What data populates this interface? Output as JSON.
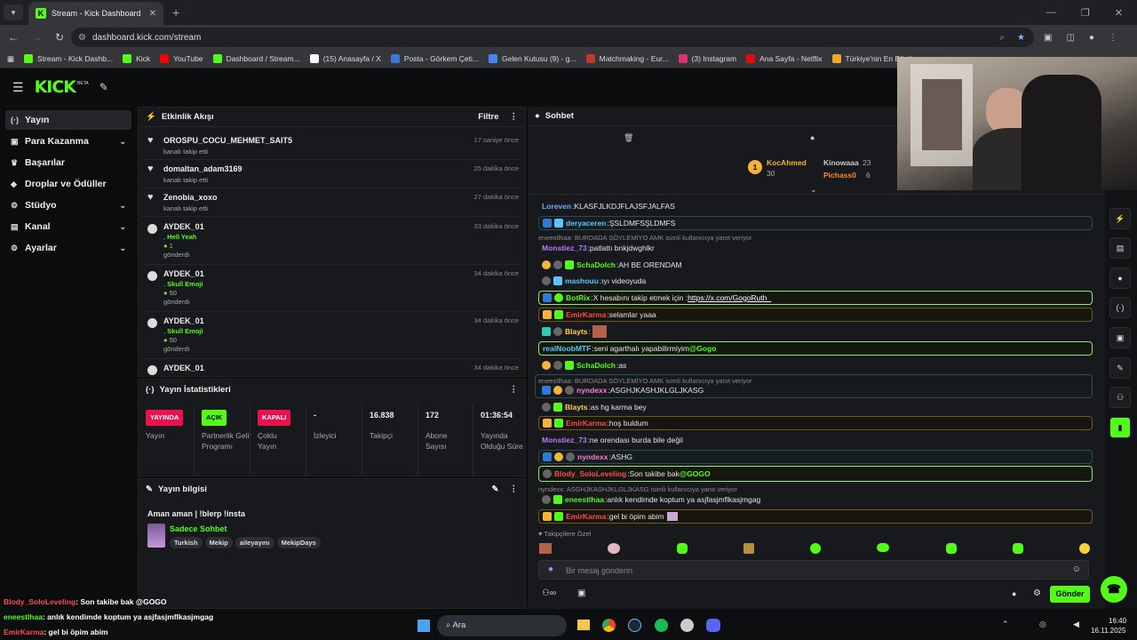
{
  "browser": {
    "tab_title": "Stream - Kick Dashboard",
    "url": "dashboard.kick.com/stream",
    "bookmarks": [
      "Stream - Kick Dashb...",
      "Kick",
      "YouTube",
      "Dashboard / Stream...",
      "(15) Anasayfa / X",
      "Posta - Görkem Çeti...",
      "Gelen Kutusu (9) - g...",
      "Matchmaking - Eur...",
      "(3) Instagram",
      "Ana Sayfa - Netflix",
      "Türkiye'nin En Büyü..."
    ]
  },
  "header": {
    "logo": "KICK",
    "beta": "BETA"
  },
  "sidebar": {
    "items": [
      {
        "label": "Yayın",
        "icon": "(·)"
      },
      {
        "label": "Para Kazanma",
        "icon": "▣"
      },
      {
        "label": "Başarılar",
        "icon": "♛"
      },
      {
        "label": "Droplar ve Ödüller",
        "icon": "◆"
      },
      {
        "label": "Stüdyo",
        "icon": "⚙"
      },
      {
        "label": "Kanal",
        "icon": "▤"
      },
      {
        "label": "Ayarlar",
        "icon": "⚙"
      }
    ]
  },
  "activity": {
    "title": "Etkinlik Akışı",
    "filter": "Filtre",
    "rows": [
      {
        "name": "OROSPU_COCU_MEHMET_SAIT5",
        "sub": "kanalı takip etti",
        "time": "17 saniye önce"
      },
      {
        "name": "domaltan_adam3169",
        "sub": "kanalı takip etti",
        "time": "25 dakika önce"
      },
      {
        "name": "Zenobia_xoxo",
        "sub": "kanalı takip etti",
        "time": "27 dakika önce"
      },
      {
        "name": "AYDEK_01",
        "gift": "Hell Yeah",
        "count": "1",
        "sub": "gönderdi",
        "time": "33 dakika önce"
      },
      {
        "name": "AYDEK_01",
        "gift": "Skull Emoji",
        "count": "50",
        "sub": "gönderdi",
        "time": "34 dakika önce"
      },
      {
        "name": "AYDEK_01",
        "gift": "Skull Emoji",
        "count": "50",
        "sub": "gönderdi",
        "time": "34 dakika önce"
      },
      {
        "name": "AYDEK_01",
        "time": "34 dakika önce"
      }
    ]
  },
  "stats": {
    "title": "Yayın İstatistikleri",
    "cols": [
      {
        "badge": "YAYINDA",
        "label": "Yayın"
      },
      {
        "badge": "AÇIK",
        "label": "Partnerlik Gelir Programı"
      },
      {
        "badge": "KAPALI",
        "label": "Çoklu Yayın"
      },
      {
        "value": "-",
        "label": "İzleyici"
      },
      {
        "value": "16.838",
        "label": "Takipçi"
      },
      {
        "value": "172",
        "label": "Abone Sayısı"
      },
      {
        "value": "01:36:54",
        "label": "Yayında Olduğu Süre"
      }
    ]
  },
  "info": {
    "title": "Yayın bilgisi",
    "stream_title": "Aman aman | !blerp !insta",
    "category": "Sadece Sohbet",
    "tags": [
      "Turkish",
      "Mekip",
      "aileyayını",
      "MekipDays"
    ]
  },
  "chat": {
    "title": "Sohbet",
    "leaders": [
      {
        "rank": "1",
        "name": "KocAhmed",
        "value": "30"
      },
      {
        "name": "Kinowaaa",
        "value": "23"
      },
      {
        "name": "Pichass0",
        "value": "6"
      }
    ],
    "messages": [
      {
        "user": "Loreven",
        "color": "#7aa7ff",
        "text": "KLASFJLKDJFLAJSFJALFAS"
      },
      {
        "user": "deryaceren",
        "color": "#57c7ff",
        "text": "ŞSLDMFSŞLDMFS"
      },
      {
        "reply": "eneestlhaa: BURDADA SÖYLEMİYO AMK isimli kullanıcıya yanıt veriyor"
      },
      {
        "user": "Monstiez_73",
        "color": "#b57cff",
        "text": "patlattı bnkjdwghlkr"
      },
      {
        "user": "SchaDolch",
        "color": "#53fc18",
        "text": "AH BE ORENDAM"
      },
      {
        "user": "mashouu",
        "color": "#57c7ff",
        "text": "ıyı videoyuda"
      },
      {
        "user": "BotRix",
        "color": "#53fc18",
        "text": "X hesabını takip etmek için : ",
        "link": "https://x.com/GogoRuth_"
      },
      {
        "user": "EmirKarma",
        "color": "#ff4d4d",
        "text": "selamlar yaaa"
      },
      {
        "user": "Blayts",
        "color": "#ffd24d",
        "text": ""
      },
      {
        "user": "realNoobMTF",
        "color": "#57c7ff",
        "text": "seni agarthalı yapabilirmiyim ",
        "mention": "@Gogo"
      },
      {
        "user": "SchaDolch",
        "color": "#53fc18",
        "text": "as"
      },
      {
        "reply": "eneestlhaa: BURDADA SÖYLEMİYO AMK isimli kullanıcıya yanıt veriyor"
      },
      {
        "user": "nyndexx",
        "color": "#ff7ad9",
        "text": "ASGHJKASHJKLGLJKASG"
      },
      {
        "user": "Blayts",
        "color": "#ffd24d",
        "text": "as hg karma bey"
      },
      {
        "user": "EmirKarma",
        "color": "#ff4d4d",
        "text": "hoş buldum"
      },
      {
        "user": "Monstiez_73",
        "color": "#b57cff",
        "text": "ne orendası burda bile değil"
      },
      {
        "user": "nyndexx",
        "color": "#ff7ad9",
        "text": "ASHG"
      },
      {
        "user": "Blody_SoloLeveling",
        "color": "#ff4d4d",
        "text": "Son takibe bak ",
        "mention": "@GOGO"
      },
      {
        "reply": "nyndexx: ASGHJKASHJKLGLJKASG isimli kullanıcıya yanıt veriyor"
      },
      {
        "user": "eneestlhaa",
        "color": "#53fc18",
        "text": "anlık kendimde koptum ya asjfasjmflkasjmgag"
      },
      {
        "user": "EmirKarma",
        "color": "#ff4d4d",
        "text": "gel bi öpim abim"
      }
    ],
    "followers_only": "Takipçilere Özel",
    "placeholder": "Bir mesaj gönderin",
    "send": "Gönder"
  },
  "overlay": [
    {
      "user": "Blody_SoloLeveling",
      "color": "#ff4d4d",
      "text": ": Son takibe bak @GOGO"
    },
    {
      "user": "eneestlhaa",
      "color": "#53fc18",
      "text": ": anlık kendimde koptum ya asjfasjmflkasjmgag"
    },
    {
      "user": "EmirKarma",
      "color": "#ff4d4d",
      "text": ": gel bi öpim abim"
    }
  ],
  "taskbar": {
    "search": "Ara",
    "time": "16:40",
    "date": "16.11.2025"
  }
}
